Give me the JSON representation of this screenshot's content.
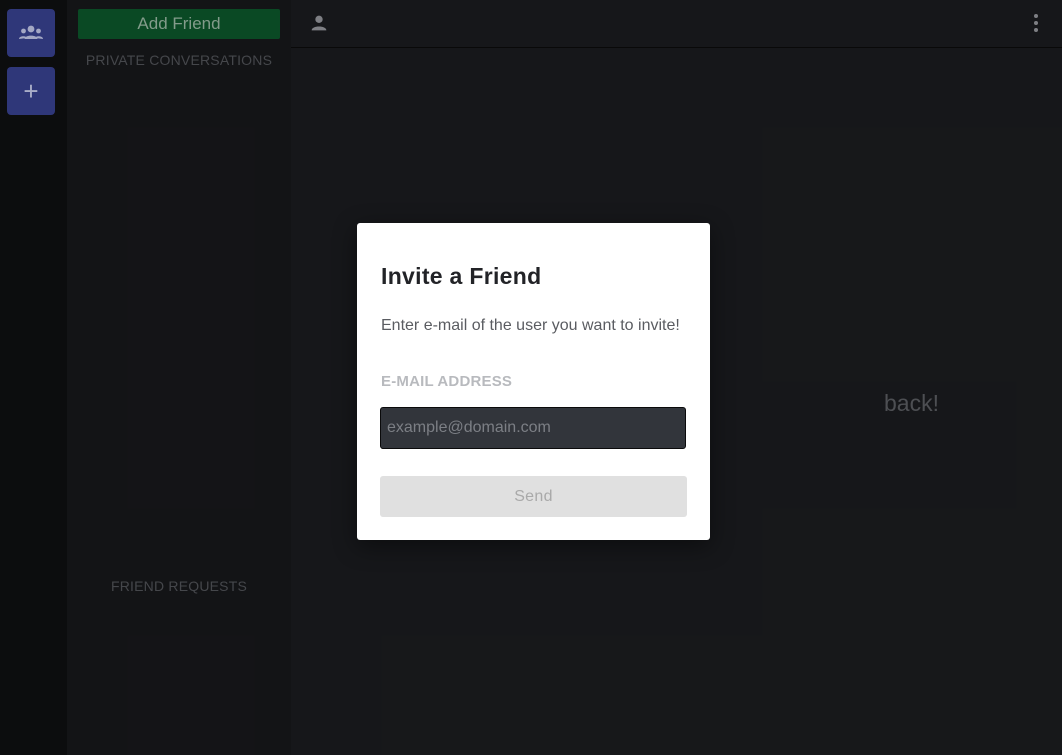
{
  "rail": {
    "items": [
      {
        "icon": "group-icon"
      },
      {
        "icon": "plus-icon",
        "label": "+"
      }
    ]
  },
  "sidebar": {
    "add_friend_label": "Add Friend",
    "private_conversations_label": "PRIVATE CONVERSATIONS",
    "friend_requests_label": "FRIEND REQUESTS"
  },
  "main": {
    "welcome_visible_fragment": "back!"
  },
  "modal": {
    "title": "Invite a Friend",
    "description": "Enter e-mail of the user you want to invite!",
    "email_label": "E-MAIL ADDRESS",
    "email_value": "",
    "email_placeholder": "example@domain.com",
    "send_label": "Send"
  },
  "colors": {
    "accent": "#3a4494",
    "add_friend": "#0d5a2d",
    "background": "#1c1d20",
    "modal_bg": "#ffffff"
  }
}
